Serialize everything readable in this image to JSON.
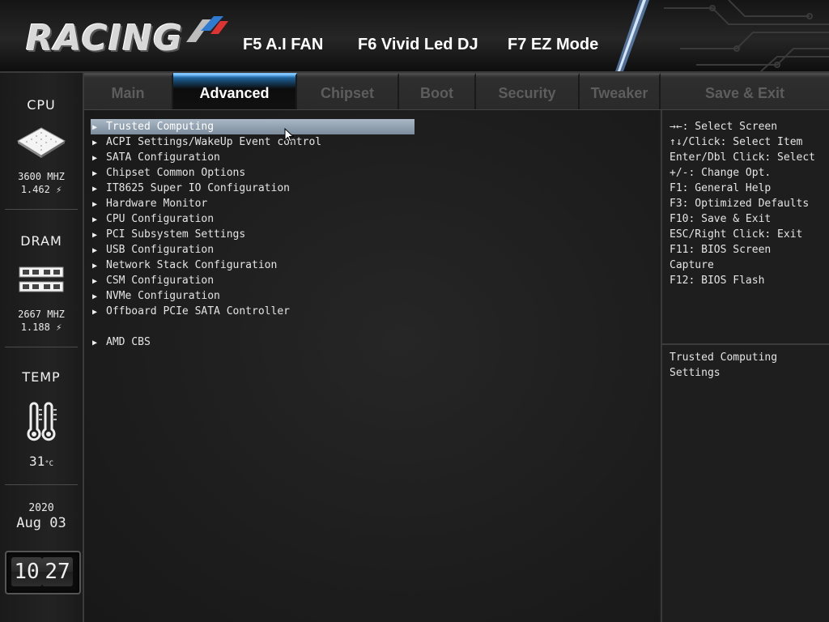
{
  "header": {
    "logo_text": "RACING",
    "hotkeys": [
      "F5 A.I FAN",
      "F6 Vivid Led DJ",
      "F7 EZ Mode"
    ]
  },
  "tabs": [
    {
      "label": "Main",
      "active": false
    },
    {
      "label": "Advanced",
      "active": true
    },
    {
      "label": "Chipset",
      "active": false
    },
    {
      "label": "Boot",
      "active": false
    },
    {
      "label": "Security",
      "active": false
    },
    {
      "label": "Tweaker",
      "active": false
    },
    {
      "label": "Save & Exit",
      "active": false
    }
  ],
  "sidebar": {
    "cpu": {
      "title": "CPU",
      "freq": "3600 MHZ",
      "volt": "1.462"
    },
    "dram": {
      "title": "DRAM",
      "freq": "2667 MHZ",
      "volt": "1.188"
    },
    "temp": {
      "title": "TEMP",
      "value": "31",
      "unit": "°C"
    },
    "date": {
      "year": "2020",
      "month_day": "Aug 03"
    },
    "clock": {
      "hour": "10",
      "minute": "27"
    }
  },
  "menu": {
    "items": [
      "Trusted Computing",
      "ACPI Settings/WakeUp Event control",
      "SATA Configuration",
      "Chipset Common Options",
      "IT8625 Super IO Configuration",
      "Hardware Monitor",
      "CPU Configuration",
      "PCI Subsystem Settings",
      "USB Configuration",
      "Network Stack Configuration",
      "CSM Configuration",
      "NVMe Configuration",
      "Offboard PCIe SATA Controller"
    ],
    "extra_item": "AMD CBS",
    "selected_index": 0
  },
  "help": {
    "keys": [
      "→←: Select Screen",
      "↑↓/Click: Select Item",
      "Enter/Dbl Click: Select",
      "+/-: Change Opt.",
      "F1: General Help",
      "F3: Optimized Defaults",
      "F10: Save & Exit",
      "ESC/Right Click: Exit",
      "F11: BIOS Screen",
      "Capture",
      "F12: BIOS Flash"
    ],
    "description": [
      "Trusted Computing",
      "Settings"
    ]
  },
  "colors": {
    "accent_tab": "#1b5e95",
    "selection": "#8c9cac",
    "background": "#1c1c1c"
  }
}
